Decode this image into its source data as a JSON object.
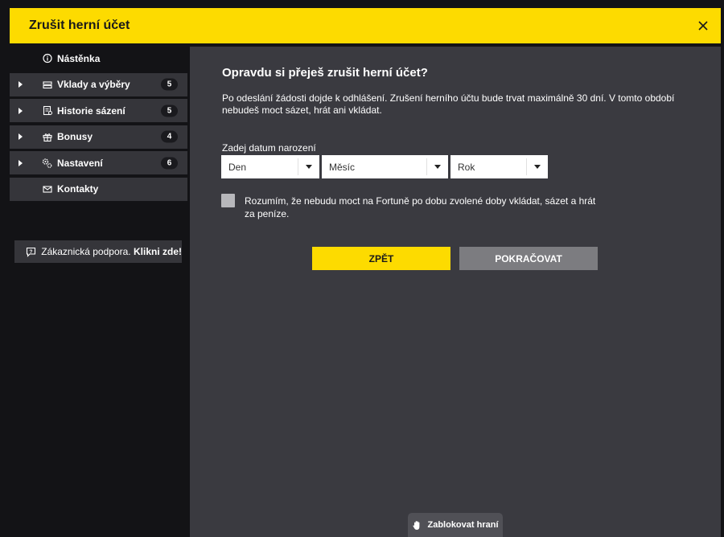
{
  "dialog": {
    "title": "Zrušit herní účet"
  },
  "sidebar": {
    "items": [
      {
        "label": "Nástěnka",
        "icon": "info-icon",
        "badge": null,
        "expandable": false
      },
      {
        "label": "Vklady a výběry",
        "icon": "money-icon",
        "badge": "5",
        "expandable": true
      },
      {
        "label": "Historie sázení",
        "icon": "ticket-icon",
        "badge": "5",
        "expandable": true
      },
      {
        "label": "Bonusy",
        "icon": "gift-icon",
        "badge": "4",
        "expandable": true
      },
      {
        "label": "Nastavení",
        "icon": "gears-icon",
        "badge": "6",
        "expandable": true
      },
      {
        "label": "Kontakty",
        "icon": "envelope-icon",
        "badge": null,
        "expandable": false
      }
    ]
  },
  "support": {
    "text": "Zákaznická podpora.",
    "link": "Klikni zde!"
  },
  "main": {
    "heading": "Opravdu si přeješ zrušit herní účet?",
    "description": "Po odeslání žádosti dojde k odhlášení. Zrušení herního účtu bude trvat maximálně 30 dní. V tomto období nebudeš moct sázet, hrát ani vkládat.",
    "dob_label": "Zadej datum narození",
    "selects": {
      "day": "Den",
      "month": "Měsíc",
      "year": "Rok"
    },
    "consent": "Rozumím, že nebudu moct na Fortuně po dobu zvolené doby vkládat, sázet a hrát za peníze.",
    "back_label": "ZPĚT",
    "continue_label": "POKRAČOVAT",
    "block_label": "Zablokovat hraní"
  },
  "colors": {
    "accent": "#fddb00",
    "panel": "#3a3a40",
    "sidebar_item": "#35353a",
    "background": "#131316"
  }
}
